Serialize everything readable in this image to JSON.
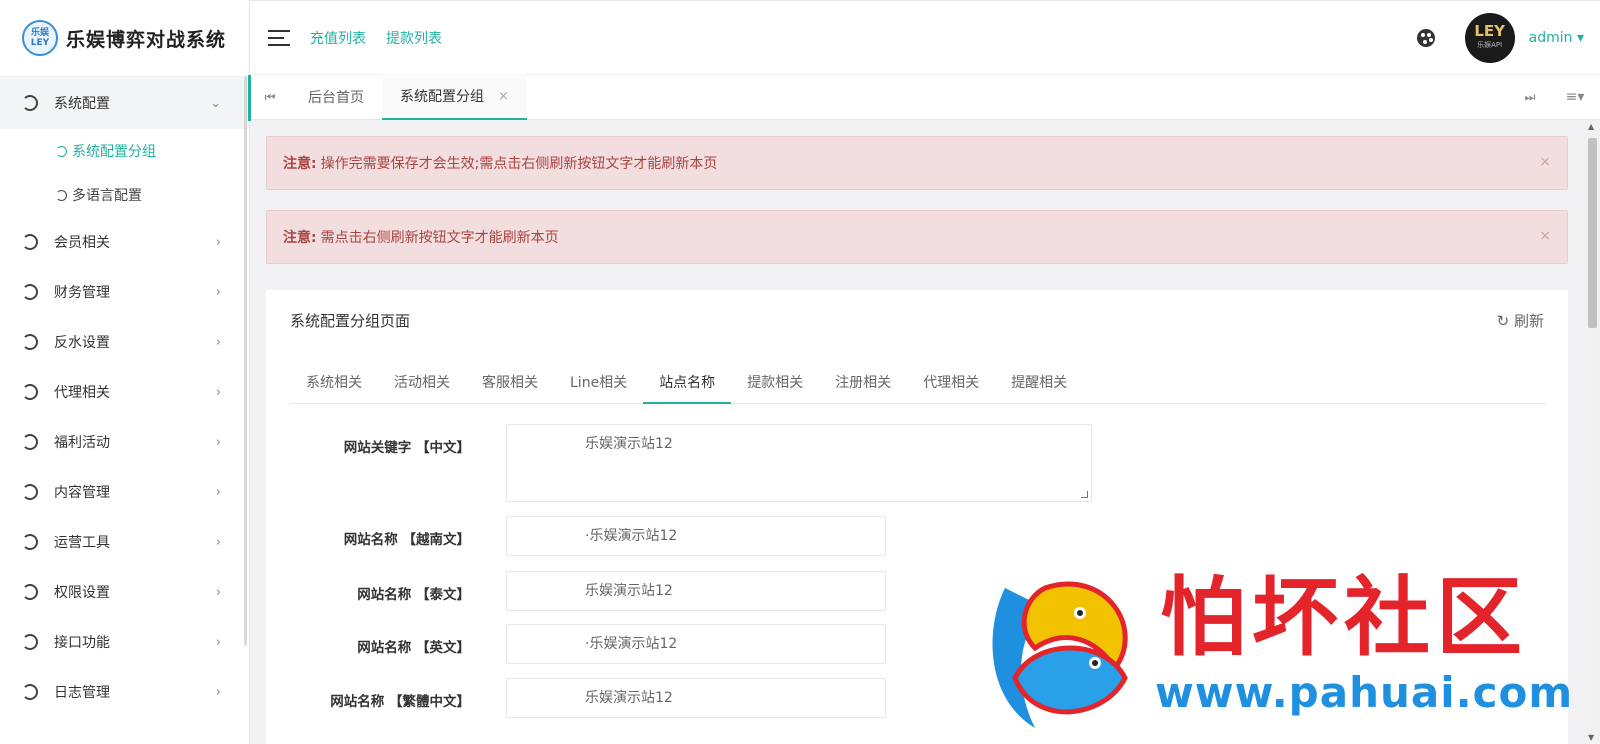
{
  "app": {
    "logo_badge": "乐娱 LEY",
    "title": "乐娱博弈对战系统"
  },
  "sidebar": {
    "items": [
      {
        "label": "系统配置",
        "arrow": "⌄",
        "open": true,
        "children": [
          {
            "label": "系统配置分组",
            "active": true
          },
          {
            "label": "多语言配置",
            "active": false
          }
        ]
      },
      {
        "label": "会员相关",
        "arrow": "›"
      },
      {
        "label": "财务管理",
        "arrow": "›"
      },
      {
        "label": "反水设置",
        "arrow": "›"
      },
      {
        "label": "代理相关",
        "arrow": "›"
      },
      {
        "label": "福利活动",
        "arrow": "›"
      },
      {
        "label": "内容管理",
        "arrow": "›"
      },
      {
        "label": "运营工具",
        "arrow": "›"
      },
      {
        "label": "权限设置",
        "arrow": "›"
      },
      {
        "label": "接口功能",
        "arrow": "›"
      },
      {
        "label": "日志管理",
        "arrow": "›"
      }
    ]
  },
  "header": {
    "links": [
      "充值列表",
      "提款列表"
    ],
    "avatar_text": "LEY",
    "avatar_sub": "乐娱API",
    "user": "admin ▾",
    "palette_icon": "palette-icon"
  },
  "tabs": {
    "items": [
      {
        "label": "后台首页",
        "active": false
      },
      {
        "label": "系统配置分组",
        "active": true,
        "close": "×"
      }
    ],
    "prev_icon": "⏮",
    "next_icon": "⏭",
    "menu_icon": "≡▾"
  },
  "alerts": [
    {
      "prefix": "注意:",
      "text": "操作完需要保存才会生效;需点击右侧刷新按钮文字才能刷新本页",
      "close": "×"
    },
    {
      "prefix": "注意:",
      "text": "需点击右侧刷新按钮文字才能刷新本页",
      "close": "×"
    }
  ],
  "card": {
    "title": "系统配置分组页面",
    "refresh_label": "↻ 刷新",
    "subtabs": [
      {
        "label": "系统相关",
        "active": false
      },
      {
        "label": "活动相关",
        "active": false
      },
      {
        "label": "客服相关",
        "active": false
      },
      {
        "label": "Line相关",
        "active": false
      },
      {
        "label": "站点名称",
        "active": true
      },
      {
        "label": "提款相关",
        "active": false
      },
      {
        "label": "注册相关",
        "active": false
      },
      {
        "label": "代理相关",
        "active": false
      },
      {
        "label": "提醒相关",
        "active": false
      }
    ],
    "fields": [
      {
        "label": "网站关键字 【中文】",
        "value": "乐娱演示站12",
        "type": "textarea"
      },
      {
        "label": "网站名称 【越南文】",
        "value": "·乐娱演示站12",
        "type": "input"
      },
      {
        "label": "网站名称 【泰文】",
        "value": "乐娱演示站12",
        "type": "input"
      },
      {
        "label": "网站名称 【英文】",
        "value": "·乐娱演示站12",
        "type": "input"
      },
      {
        "label": "网站名称 【繁體中文】",
        "value": "乐娱演示站12",
        "type": "input"
      }
    ]
  },
  "watermark": {
    "title": "怕坏社区",
    "url": "www.pahuai.com"
  },
  "colors": {
    "accent": "#20b2a0",
    "alert_bg": "#f2dede",
    "alert_text": "#a94442",
    "watermark_red": "#e3242b",
    "watermark_blue": "#1f8fe0"
  }
}
